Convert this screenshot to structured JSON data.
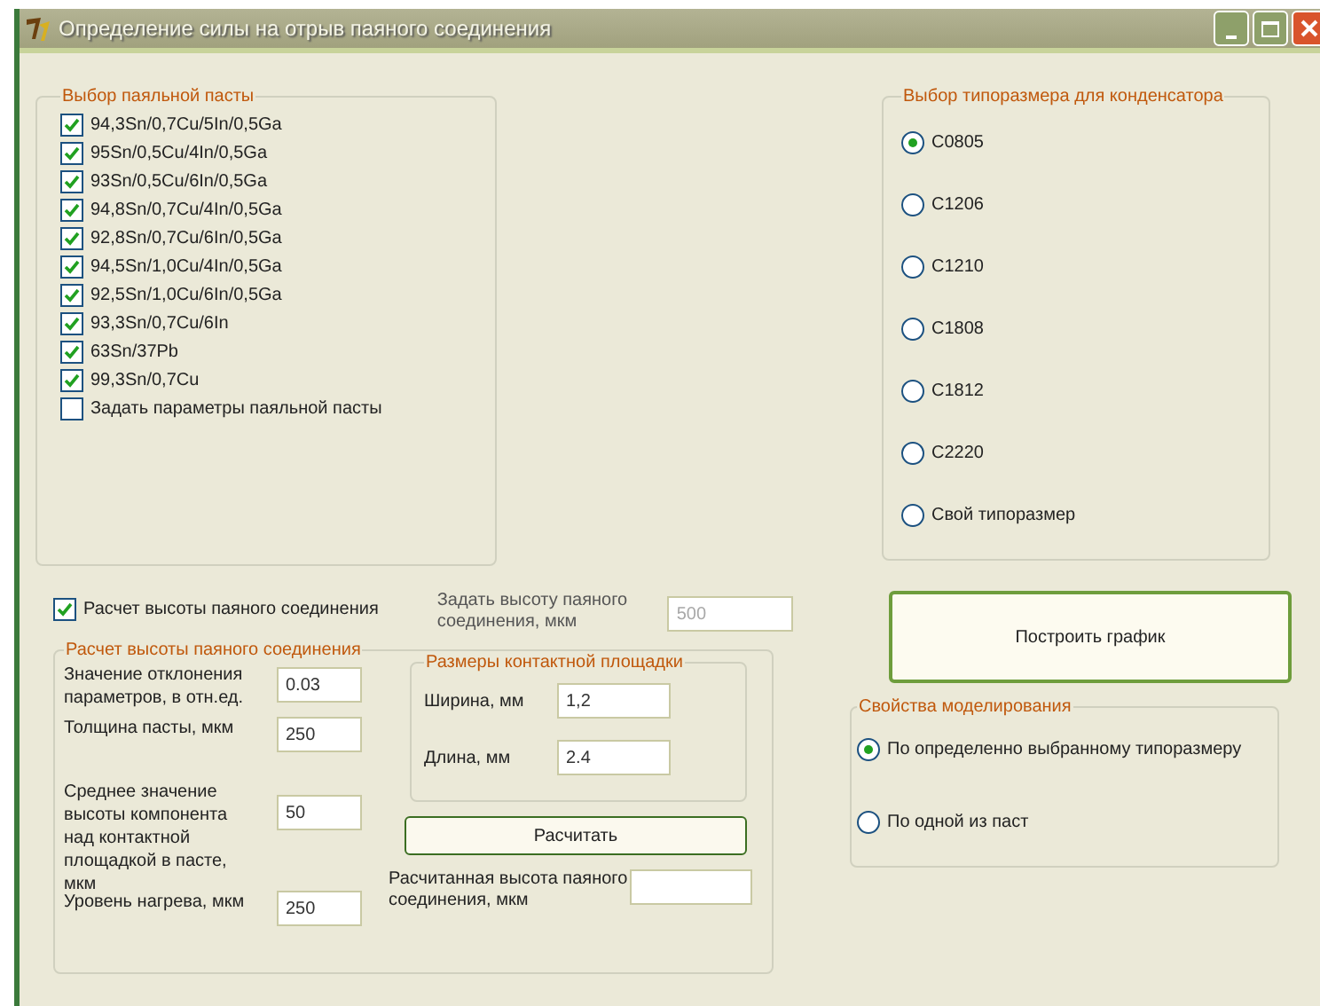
{
  "window": {
    "title": "Определение силы на отрыв паяного соединения"
  },
  "paste_group": {
    "title": "Выбор паяльной пасты",
    "items": [
      {
        "label": "94,3Sn/0,7Cu/5In/0,5Ga",
        "checked": true
      },
      {
        "label": "95Sn/0,5Cu/4In/0,5Ga",
        "checked": true
      },
      {
        "label": "93Sn/0,5Cu/6In/0,5Ga",
        "checked": true
      },
      {
        "label": "94,8Sn/0,7Cu/4In/0,5Ga",
        "checked": true
      },
      {
        "label": "92,8Sn/0,7Cu/6In/0,5Ga",
        "checked": true
      },
      {
        "label": "94,5Sn/1,0Cu/4In/0,5Ga",
        "checked": true
      },
      {
        "label": "92,5Sn/1,0Cu/6In/0,5Ga",
        "checked": true
      },
      {
        "label": "93,3Sn/0,7Cu/6In",
        "checked": true
      },
      {
        "label": "63Sn/37Pb",
        "checked": true
      },
      {
        "label": "99,3Sn/0,7Cu",
        "checked": true
      },
      {
        "label": "Задать параметры паяльной пасты",
        "checked": false
      }
    ]
  },
  "size_group": {
    "title": "Выбор типоразмера для конденсатора",
    "options": [
      {
        "label": "C0805",
        "selected": true
      },
      {
        "label": "C1206",
        "selected": false
      },
      {
        "label": "C1210",
        "selected": false
      },
      {
        "label": "C1808",
        "selected": false
      },
      {
        "label": "C1812",
        "selected": false
      },
      {
        "label": "C2220",
        "selected": false
      },
      {
        "label": "Свой типоразмер",
        "selected": false
      }
    ]
  },
  "height_calc_toggle": {
    "label": "Расчет высоты паяного соединения",
    "checked": true
  },
  "set_height": {
    "label": "Задать высоту паяного соединения, мкм",
    "value": "500",
    "disabled": true
  },
  "plot_button": "Построить график",
  "calc_group": {
    "title": "Расчет высоты паяного соединения",
    "fields": [
      {
        "label": "Значение отклонения параметров, в отн.ед.",
        "value": "0.03"
      },
      {
        "label": "Толщина пасты, мкм",
        "value": "250"
      },
      {
        "label": "Среднее значение высоты компонента над контактной площадкой в пасте, мкм",
        "value": "50"
      },
      {
        "label": "Уровень нагрева, мкм",
        "value": "250"
      }
    ],
    "pad_group": {
      "title": "Размеры контактной площадки",
      "fields": [
        {
          "label": "Ширина, мм",
          "value": "1,2"
        },
        {
          "label": "Длина, мм",
          "value": "2.4"
        }
      ]
    },
    "calc_button": "Расчитать",
    "result": {
      "label": "Расчитанная высота паяного соединения, мкм"
    }
  },
  "sim_group": {
    "title": "Свойства моделирования",
    "options": [
      {
        "label": "По определенно выбранному типоразмеру",
        "selected": true
      },
      {
        "label": "По одной из паст",
        "selected": false
      }
    ]
  }
}
